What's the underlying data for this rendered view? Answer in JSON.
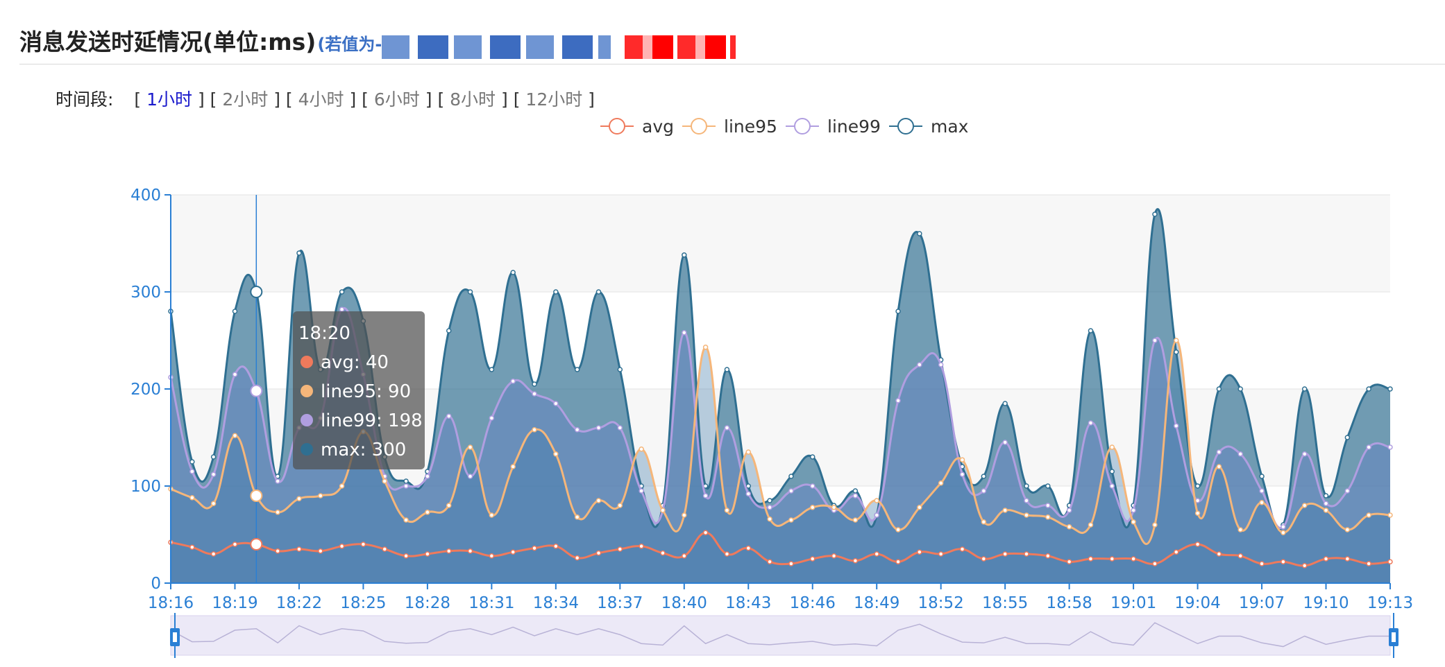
{
  "page": {
    "title": "消息发送时延情况(单位:ms)",
    "title_note": "(若值为-",
    "colors": {
      "title_note": "#3a6fc4",
      "active_option": "#1a1acc"
    }
  },
  "time_range": {
    "label": "时间段:",
    "options": [
      "1小时",
      "2小时",
      "4小时",
      "6小时",
      "8小时",
      "12小时"
    ],
    "selected": "1小时"
  },
  "chart_data": {
    "type": "area",
    "y_axis": {
      "min": 0,
      "max": 400,
      "ticks": [
        0,
        100,
        200,
        300,
        400
      ]
    },
    "x": [
      "18:16",
      "18:17",
      "18:18",
      "18:19",
      "18:20",
      "18:21",
      "18:22",
      "18:23",
      "18:24",
      "18:25",
      "18:26",
      "18:27",
      "18:28",
      "18:29",
      "18:30",
      "18:31",
      "18:32",
      "18:33",
      "18:34",
      "18:35",
      "18:36",
      "18:37",
      "18:38",
      "18:39",
      "18:40",
      "18:41",
      "18:42",
      "18:43",
      "18:44",
      "18:45",
      "18:46",
      "18:47",
      "18:48",
      "18:49",
      "18:50",
      "18:51",
      "18:52",
      "18:53",
      "18:54",
      "18:55",
      "18:56",
      "18:57",
      "18:58",
      "18:59",
      "19:00",
      "19:01",
      "19:02",
      "19:03",
      "19:04",
      "19:05",
      "19:06",
      "19:07",
      "19:08",
      "19:09",
      "19:10",
      "19:11",
      "19:12",
      "19:13"
    ],
    "x_tick_labels": [
      "18:16",
      "18:19",
      "18:22",
      "18:25",
      "18:28",
      "18:31",
      "18:34",
      "18:37",
      "18:40",
      "18:43",
      "18:46",
      "18:49",
      "18:52",
      "18:55",
      "18:58",
      "19:01",
      "19:04",
      "19:07",
      "19:10",
      "19:13"
    ],
    "series": [
      {
        "name": "max",
        "color": "#2f6f91",
        "values": [
          280,
          125,
          130,
          280,
          300,
          110,
          340,
          220,
          300,
          270,
          130,
          105,
          115,
          260,
          300,
          220,
          320,
          205,
          300,
          220,
          300,
          220,
          100,
          80,
          338,
          100,
          220,
          100,
          85,
          110,
          130,
          80,
          95,
          70,
          280,
          360,
          230,
          120,
          110,
          185,
          100,
          100,
          80,
          260,
          115,
          80,
          380,
          238,
          100,
          200,
          200,
          110,
          60,
          200,
          90,
          150,
          200,
          200
        ]
      },
      {
        "name": "line99",
        "color": "#b09ee0",
        "values": [
          212,
          115,
          112,
          215,
          198,
          105,
          160,
          170,
          282,
          215,
          110,
          100,
          110,
          172,
          110,
          170,
          208,
          195,
          185,
          158,
          160,
          160,
          95,
          75,
          258,
          90,
          160,
          92,
          78,
          95,
          100,
          75,
          90,
          70,
          188,
          225,
          225,
          112,
          95,
          145,
          85,
          80,
          75,
          165,
          100,
          75,
          250,
          162,
          85,
          135,
          133,
          95,
          58,
          133,
          82,
          95,
          140,
          140
        ]
      },
      {
        "name": "line95",
        "color": "#f5b67a",
        "values": [
          97,
          88,
          82,
          152,
          90,
          73,
          87,
          90,
          100,
          156,
          105,
          65,
          73,
          80,
          140,
          70,
          120,
          158,
          133,
          68,
          85,
          80,
          138,
          75,
          70,
          243,
          75,
          135,
          66,
          65,
          78,
          78,
          65,
          85,
          55,
          78,
          103,
          127,
          63,
          75,
          70,
          68,
          58,
          60,
          140,
          63,
          60,
          250,
          72,
          120,
          55,
          83,
          52,
          80,
          75,
          55,
          70,
          70
        ]
      },
      {
        "name": "avg",
        "color": "#ef7a5c",
        "values": [
          42,
          37,
          30,
          40,
          40,
          33,
          35,
          33,
          38,
          40,
          35,
          28,
          30,
          33,
          33,
          28,
          32,
          36,
          38,
          26,
          31,
          35,
          38,
          31,
          28,
          52,
          30,
          36,
          22,
          20,
          25,
          28,
          23,
          30,
          22,
          32,
          30,
          35,
          25,
          30,
          30,
          28,
          22,
          25,
          25,
          25,
          20,
          32,
          40,
          30,
          28,
          20,
          22,
          18,
          25,
          25,
          20,
          22
        ]
      }
    ],
    "legend": [
      "avg",
      "line95",
      "line99",
      "max"
    ],
    "legend_position": "top-center",
    "grid": true,
    "tooltip": {
      "title": "18:20",
      "items": [
        {
          "name": "avg",
          "value": 40
        },
        {
          "name": "line95",
          "value": 90
        },
        {
          "name": "line99",
          "value": 198
        },
        {
          "name": "max",
          "value": 300
        }
      ],
      "index": 4
    },
    "data_zoom": true
  }
}
